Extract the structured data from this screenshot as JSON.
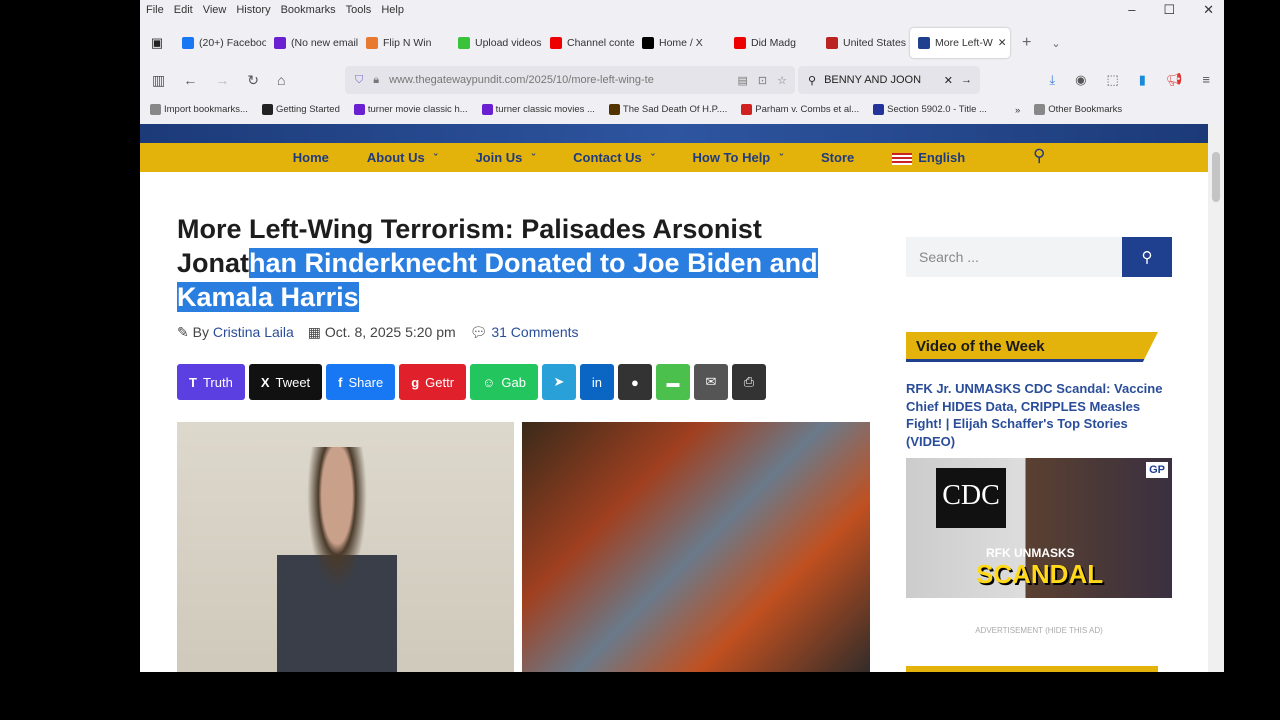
{
  "menu": [
    "File",
    "Edit",
    "View",
    "History",
    "Bookmarks",
    "Tools",
    "Help"
  ],
  "tabs": [
    {
      "label": "(20+) Facebook",
      "color": "#1877f2"
    },
    {
      "label": "(No new email",
      "color": "#6a1fd0"
    },
    {
      "label": "Flip N Win",
      "color": "#e87a30"
    },
    {
      "label": "Upload videos",
      "color": "#3bc23b"
    },
    {
      "label": "Channel conte",
      "color": "#e00"
    },
    {
      "label": "Home / X",
      "color": "#000"
    },
    {
      "label": "Did Madg",
      "color": "#e00"
    },
    {
      "label": "United States",
      "color": "#b22"
    },
    {
      "label": "More Left-W",
      "color": "#1f3f8f"
    }
  ],
  "url": "www.thegatewaypundit.com/2025/10/more-left-wing-te",
  "search_value": "BENNY AND JOON",
  "bookmarks": [
    {
      "label": "Import bookmarks...",
      "color": "#888"
    },
    {
      "label": "Getting Started",
      "color": "#222"
    },
    {
      "label": "turner movie classic h...",
      "color": "#6a1fd0"
    },
    {
      "label": "turner classic movies ...",
      "color": "#6a1fd0"
    },
    {
      "label": "The Sad Death Of H.P....",
      "color": "#553300"
    },
    {
      "label": "Parham v. Combs et al...",
      "color": "#d02020"
    },
    {
      "label": "Section 5902.0 - Title ...",
      "color": "#223399"
    },
    {
      "label": "Other Bookmarks",
      "color": "#888"
    }
  ],
  "site_nav": [
    "Home",
    "About Us",
    "Join Us",
    "Contact Us",
    "How To Help",
    "Store",
    "English"
  ],
  "article": {
    "title_plain": "More Left-Wing Terrorism: Palisades Arsonist Jonat",
    "title_selected": "han Rinderknecht Donated to Joe Biden and Kamala Harris",
    "by": "By",
    "author": "Cristina Laila",
    "date": "Oct. 8, 2025 5:20 pm",
    "comments": "31 Comments"
  },
  "share": [
    {
      "label": "Truth",
      "color": "#5b3fe0",
      "icon": "T"
    },
    {
      "label": "Tweet",
      "color": "#111",
      "icon": "X"
    },
    {
      "label": "Share",
      "color": "#1877f2",
      "icon": "f"
    },
    {
      "label": "Gettr",
      "color": "#e0202a",
      "icon": "g"
    },
    {
      "label": "Gab",
      "color": "#22c55e",
      "icon": "☺"
    }
  ],
  "share_icons": [
    {
      "name": "telegram",
      "color": "#2aa0d8",
      "icon": "➤"
    },
    {
      "name": "linkedin",
      "color": "#0a66c2",
      "icon": "in"
    },
    {
      "name": "comment",
      "color": "#333",
      "icon": "●"
    },
    {
      "name": "sms",
      "color": "#4cc04c",
      "icon": "▬"
    },
    {
      "name": "email",
      "color": "#555",
      "icon": "✉"
    },
    {
      "name": "print",
      "color": "#333",
      "icon": "⎙"
    }
  ],
  "sidebar": {
    "search_placeholder": "Search ...",
    "video_heading": "Video of the Week",
    "video_title": "RFK Jr. UNMASKS CDC Scandal: Vaccine Chief HIDES Data, CRIPPLES Measles Fight! | Elijah Schaffer's Top Stories (VIDEO)",
    "thumb_cdc": "CDC",
    "thumb_rfk": "RFK UNMASKS",
    "thumb_scandal": "SCANDAL",
    "thumb_gp": "GP",
    "ad_label": "ADVERTISEMENT (HIDE THIS AD)"
  }
}
